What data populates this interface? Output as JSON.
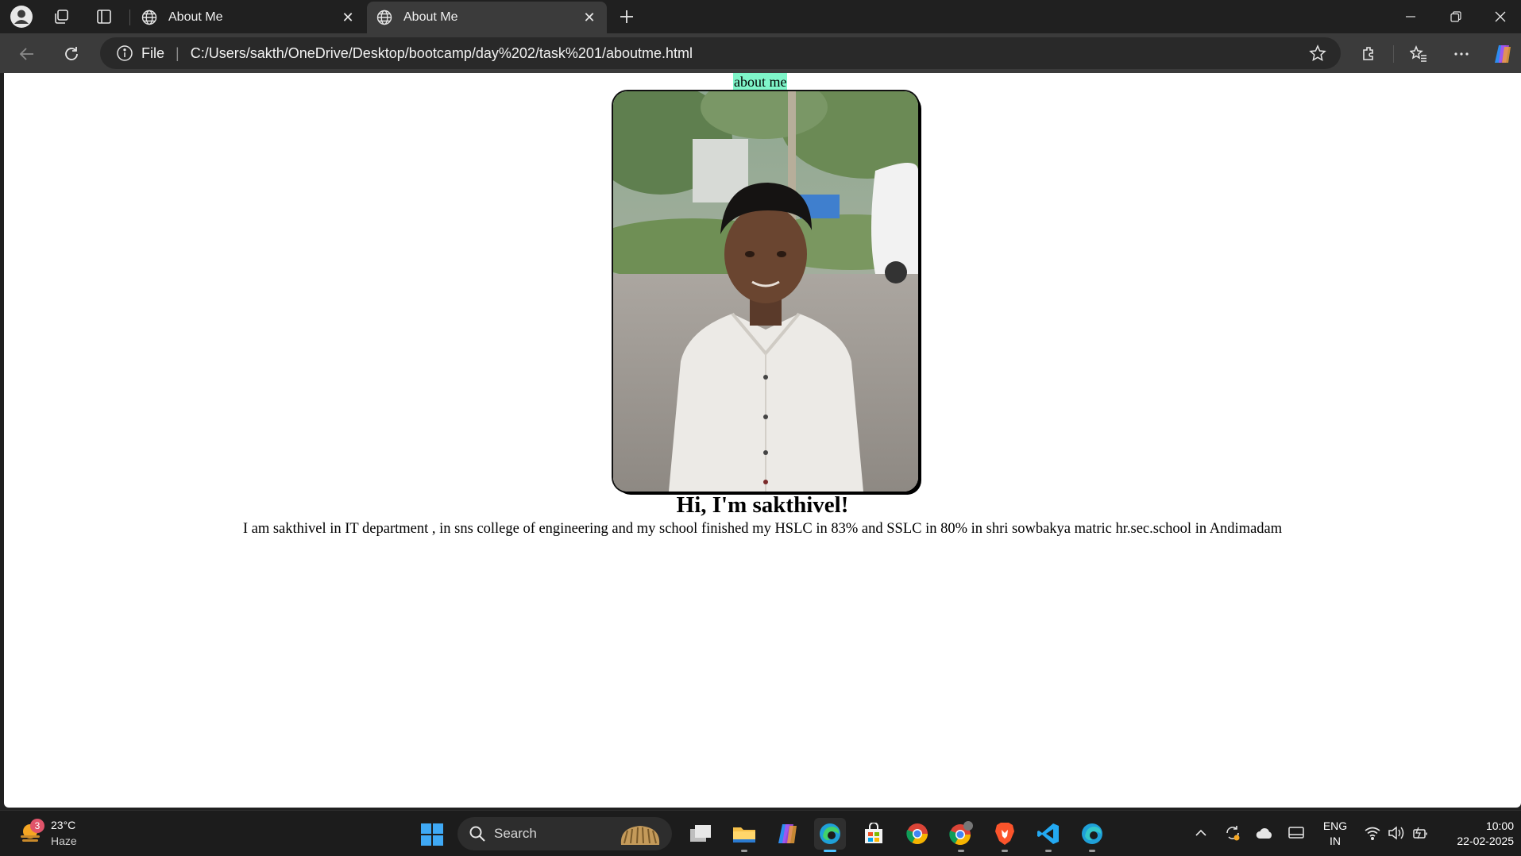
{
  "browser": {
    "tabs": [
      {
        "title": "About Me",
        "active": false
      },
      {
        "title": "About Me",
        "active": true
      }
    ],
    "address": {
      "scheme_label": "File",
      "url": "C:/Users/sakth/OneDrive/Desktop/bootcamp/day%202/task%201/aboutme.html"
    }
  },
  "page": {
    "heading": "about me",
    "heading_bg": "#7ff5c9",
    "greeting": "Hi, I'm sakthivel!",
    "bio": "I am sakthivel in IT department , in sns college of engineering and my school finished my HSLC in 83% and SSLC in 80% in shri sowbakya matric hr.sec.school in Andimadam"
  },
  "taskbar": {
    "weather": {
      "temp": "23°C",
      "condition": "Haze",
      "badge": "3"
    },
    "search_label": "Search",
    "apps": [
      "task-view",
      "file-explorer",
      "copilot",
      "edge",
      "store",
      "chrome",
      "chrome-profile",
      "brave",
      "vscode",
      "edge-dev"
    ],
    "lang_top": "ENG",
    "lang_bottom": "IN",
    "time": "10:00",
    "date": "22-02-2025"
  }
}
